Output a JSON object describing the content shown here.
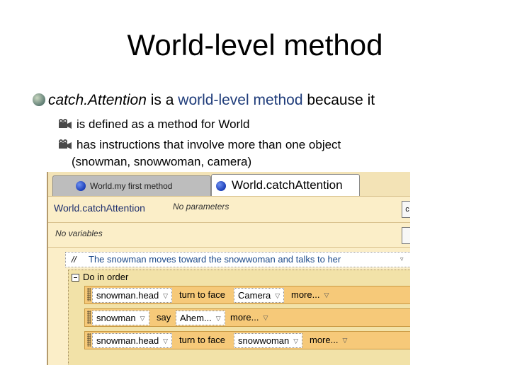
{
  "slide": {
    "title": "World-level method",
    "bullet": {
      "part1": "catch.Attention",
      "part2": " is a ",
      "part3": "world-level method",
      "part4": " because it"
    },
    "sub1": "is defined as a method for World",
    "sub2": "has instructions that involve more than one object",
    "sub2_cont": "(snowman, snowwoman, camera)"
  },
  "editor": {
    "tabs": [
      {
        "label": "World.my first method"
      },
      {
        "label": "World.catchAttention"
      }
    ],
    "method_name": "World.catchAttention",
    "params": "No parameters",
    "right_btn1": "c",
    "variables": "No variables",
    "comment": {
      "prefix": "//",
      "text": "The snowman  moves toward the snowwoman and talks to her"
    },
    "do_in_order": "Do in order",
    "statements": [
      {
        "object": "snowman.head",
        "method": "turn to face",
        "arg": "Camera",
        "more": "more..."
      },
      {
        "object": "snowman",
        "method": "say",
        "arg": "Ahem...",
        "more": "more..."
      },
      {
        "object": "snowman.head",
        "method": "turn to face",
        "arg": "snowwoman",
        "more": "more..."
      }
    ]
  }
}
